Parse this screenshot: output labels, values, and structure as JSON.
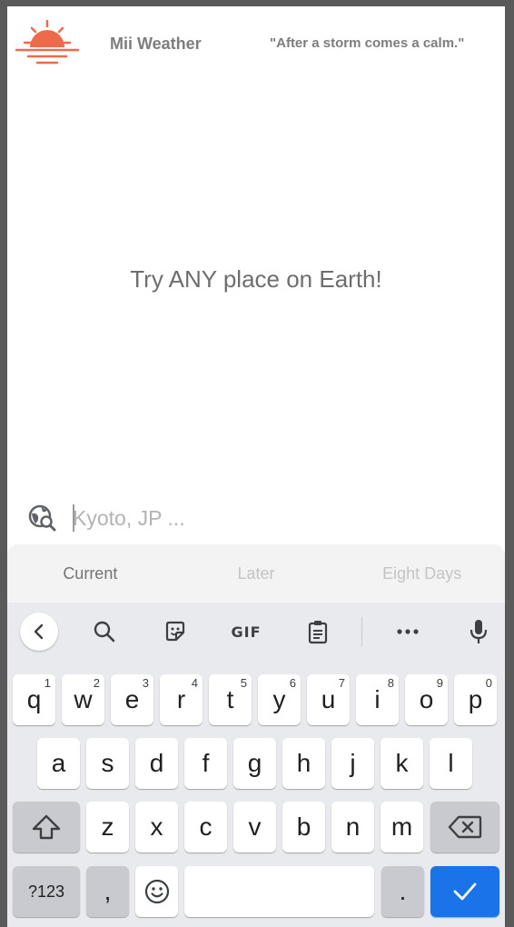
{
  "header": {
    "app_title": "Mii Weather",
    "quote": "\"After a storm comes a calm.\"",
    "logo_color": "#ee6a4a"
  },
  "main": {
    "hero_text": "Try ANY place on Earth!"
  },
  "search": {
    "placeholder": "Kyoto, JP ...",
    "value": "",
    "icon": "travel-explore-icon"
  },
  "tabs": [
    {
      "label": "Current",
      "active": true
    },
    {
      "label": "Later",
      "active": false
    },
    {
      "label": "Eight Days",
      "active": false
    }
  ],
  "keyboard": {
    "toolbar": [
      "back-chevron-icon",
      "search-icon",
      "sticker-icon",
      "gif-icon",
      "clipboard-icon",
      "more-icon",
      "microphone-icon"
    ],
    "gif_label": "GIF",
    "row1": [
      {
        "k": "q",
        "h": "1"
      },
      {
        "k": "w",
        "h": "2"
      },
      {
        "k": "e",
        "h": "3"
      },
      {
        "k": "r",
        "h": "4"
      },
      {
        "k": "t",
        "h": "5"
      },
      {
        "k": "y",
        "h": "6"
      },
      {
        "k": "u",
        "h": "7"
      },
      {
        "k": "i",
        "h": "8"
      },
      {
        "k": "o",
        "h": "9"
      },
      {
        "k": "p",
        "h": "0"
      }
    ],
    "row2": [
      "a",
      "s",
      "d",
      "f",
      "g",
      "h",
      "j",
      "k",
      "l"
    ],
    "row3": [
      "z",
      "x",
      "c",
      "v",
      "b",
      "n",
      "m"
    ],
    "symbols_label": "?123",
    "comma_label": ",",
    "period_label": ".",
    "accent_color": "#1a73e8"
  }
}
